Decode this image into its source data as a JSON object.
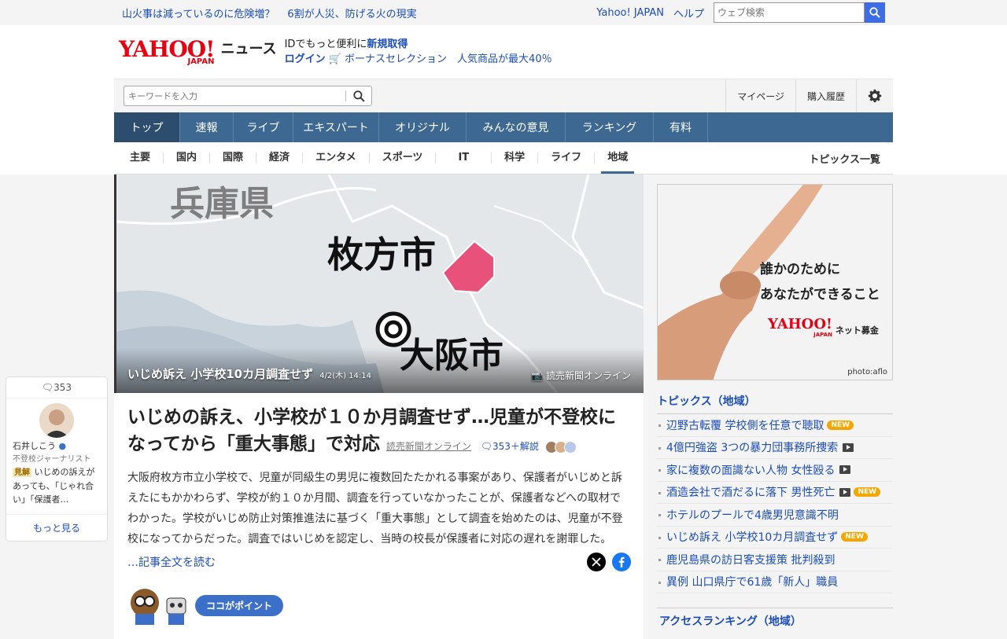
{
  "topbar": {
    "headline1": "山火事は減っているのに危険増？",
    "headline2": "6割が人災、防げる火の現実",
    "yahoo_japan": "Yahoo! JAPAN",
    "help": "ヘルプ",
    "web_search_placeholder": "ウェブ検索"
  },
  "header": {
    "logo_yahoo": "YAHOO!",
    "logo_japan": "JAPAN",
    "logo_news": "ニュース",
    "id_text": "IDでもっと便利に",
    "signup": "新規取得",
    "login": "ログイン",
    "promo": "ボーナスセレクション　人気商品が最大40％"
  },
  "search": {
    "placeholder": "キーワードを入力",
    "mypage": "マイページ",
    "history": "購入履歴"
  },
  "nav": {
    "items": [
      "トップ",
      "速報",
      "ライブ",
      "エキスパート",
      "オリジナル",
      "みんなの意見",
      "ランキング",
      "有料"
    ]
  },
  "subnav": {
    "items": [
      "主要",
      "国内",
      "国際",
      "経済",
      "エンタメ",
      "スポーツ",
      "IT",
      "科学",
      "ライフ",
      "地域"
    ],
    "topics_all": "トピックス一覧"
  },
  "hero": {
    "map_label_hyogo": "兵庫県",
    "map_label_hirakata": "枚方市",
    "map_label_osaka": "大阪市",
    "caption": "いじめ訴え 小学校10カ月調査せず",
    "time": "4/2(木) 14:14",
    "source": "読売新聞オンライン"
  },
  "article": {
    "headline": "いじめの訴え、小学校が１０か月調査せず…児童が不登校になってから「重大事態」で対応",
    "source": "読売新聞オンライン",
    "comments": "353＋解説",
    "body": "大阪府枚方市立小学校で、児童が同級生の男児に複数回たたかれる事案があり、保護者がいじめと訴えたにもかかわらず、学校が約１０か月間、調査を行っていなかったことが、保護者などへの取材でわかった。学校がいじめ防止対策推進法に基づく「重大事態」として調査を始めたのは、児童が不登校になってからだった。調査ではいじめを認定し、当時の校長が保護者に対応の遅れを謝罪した。",
    "read_more": "…記事全文を読む",
    "point_label": "ココがポイント"
  },
  "ad": {
    "line1": "誰かのために",
    "line2": "あなたができること",
    "logo_yahoo": "YAHOO!",
    "logo_japan": "JAPAN",
    "logo_service": "ネット募金",
    "credit": "photo:aflo"
  },
  "topics": {
    "title": "トピックス（地域）",
    "items": [
      {
        "text": "辺野古転覆 学校側を任意で聴取",
        "new": true,
        "video": false
      },
      {
        "text": "4億円強盗 3つの暴力団事務所捜索",
        "new": false,
        "video": true
      },
      {
        "text": "家に複数の面識ない人物 女性殴る",
        "new": false,
        "video": true
      },
      {
        "text": "酒造会社で酒だるに落下 男性死亡",
        "new": true,
        "video": true
      },
      {
        "text": "ホテルのプールで4歳男児意識不明",
        "new": false,
        "video": false
      },
      {
        "text": "いじめ訴え 小学校10カ月調査せず",
        "new": true,
        "video": false
      },
      {
        "text": "鹿児島県の訪日客支援策 批判殺到",
        "new": false,
        "video": false
      },
      {
        "text": "異例 山口県庁で61歳「新人」職員",
        "new": false,
        "video": false
      }
    ],
    "new_label": "NEW"
  },
  "ranking": {
    "title": "アクセスランキング（地域）"
  },
  "expert": {
    "count": "353",
    "name": "石井しこう",
    "role": "不登校ジャーナリスト",
    "tag": "見解",
    "comment": "いじめの訴えがあっても、「じゃれ合い」「保護者…",
    "more": "もっと見る"
  },
  "colors": {
    "nav": "#3c6891",
    "link": "#1b4dbc",
    "brand": "#e60012"
  }
}
